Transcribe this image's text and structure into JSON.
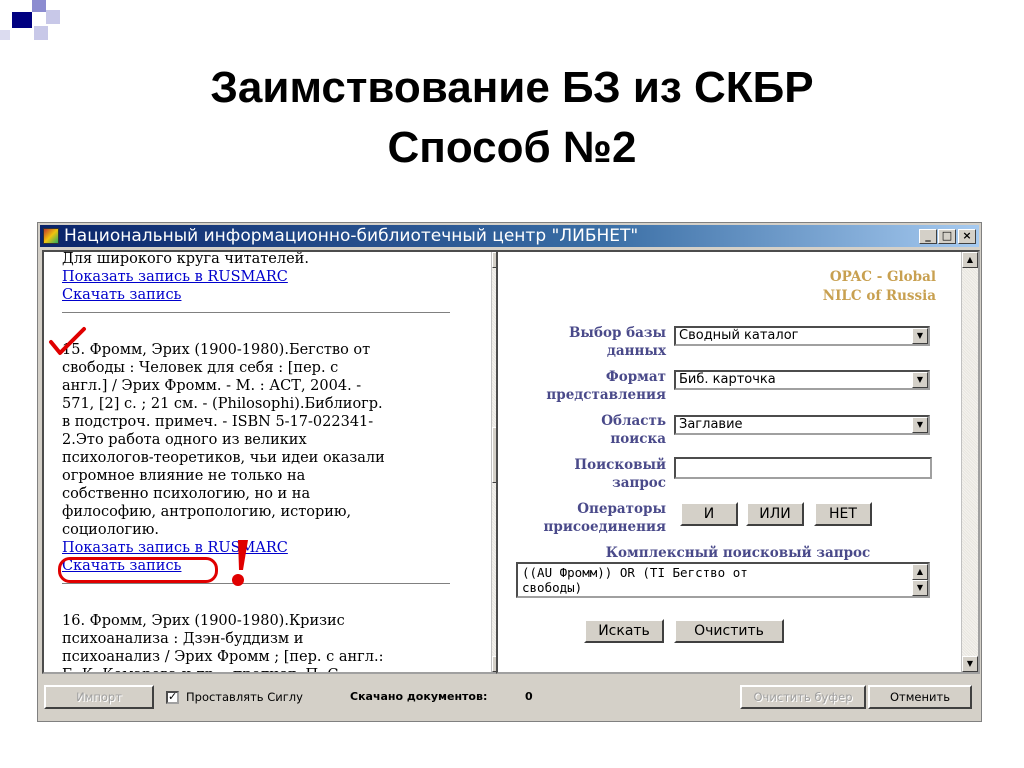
{
  "slide": {
    "title_line1": "Заимствование БЗ из СКБР",
    "title_line2": "Способ №2",
    "accent_colors": [
      "#000080",
      "#8c8cd0",
      "#c8c8e8"
    ]
  },
  "window": {
    "title": "Национальный информационно-библиотечный центр \"ЛИБНЕТ\"",
    "minimize_glyph": "_",
    "maximize_glyph": "□",
    "close_glyph": "×",
    "titlebar_color": "#0a246a"
  },
  "left_pane": {
    "top_text": "Для широкого круга читателей.",
    "record14": {
      "show_link": "Показать запись в RUSMARC",
      "download_link": "Скачать запись"
    },
    "record15": {
      "lines": [
        "15. Фромм, Эрих (1900-1980).Бегство от",
        "свободы : Человек для себя : [пер. с",
        "англ.] / Эрих Фромм. - М. : АСТ, 2004. -",
        "571, [2] с. ; 21 см. - (Philosophi).Библиогр.",
        "в подстроч. примеч. - ISBN 5-17-022341-",
        "2.Это работа одного из великих",
        "психологов-теоретиков, чьи идеи оказали",
        "огромное влияние не только на",
        "собственно психологию, но и на",
        "философию, антропологию, историю,",
        "социологию."
      ],
      "show_link": "Показать запись в RUSMARC",
      "download_link": "Скачать запись"
    },
    "record16": {
      "lines": [
        "16. Фромм, Эрих (1900-1980).Кризис",
        "психоанализа : Дзэн-буддизм и",
        "психоанализ / Эрих Фромм ; [пер. с англ.:",
        "Б. К. Комарова и др. ; предисл. П. С."
      ]
    },
    "annotation_color": "#e00000"
  },
  "right_pane": {
    "opac_line1": "OPAC - Global",
    "opac_line2": "NILC of Russia",
    "db_label_1": "Выбор базы",
    "db_label_2": "данных",
    "db_value": "Сводный каталог",
    "format_label_1": "Формат",
    "format_label_2": "представления",
    "format_value": "Биб. карточка",
    "area_label_1": "Область",
    "area_label_2": "поиска",
    "area_value": "Заглавие",
    "query_label_1": "Поисковый",
    "query_label_2": "запрос",
    "query_value": "",
    "ops_label_1": "Операторы",
    "ops_label_2": "присоединения",
    "op_and": "И",
    "op_or": "ИЛИ",
    "op_not": "НЕТ",
    "complex_label": "Комплексный поисковый запрос",
    "complex_line1": "((AU Фромм)) OR (TI Бегство от",
    "complex_line2": "свободы)",
    "search_button": "Искать",
    "clear_button": "Очистить"
  },
  "statusbar": {
    "import_button": "Импорт",
    "checkbox_checked": true,
    "checkbox_glyph": "✓",
    "checkbox_label": "Проставлять Сиглу",
    "downloaded_label": "Скачано документов:",
    "downloaded_count": "0",
    "clear_buffer_button": "Очистить буфер",
    "cancel_button": "Отменить"
  }
}
